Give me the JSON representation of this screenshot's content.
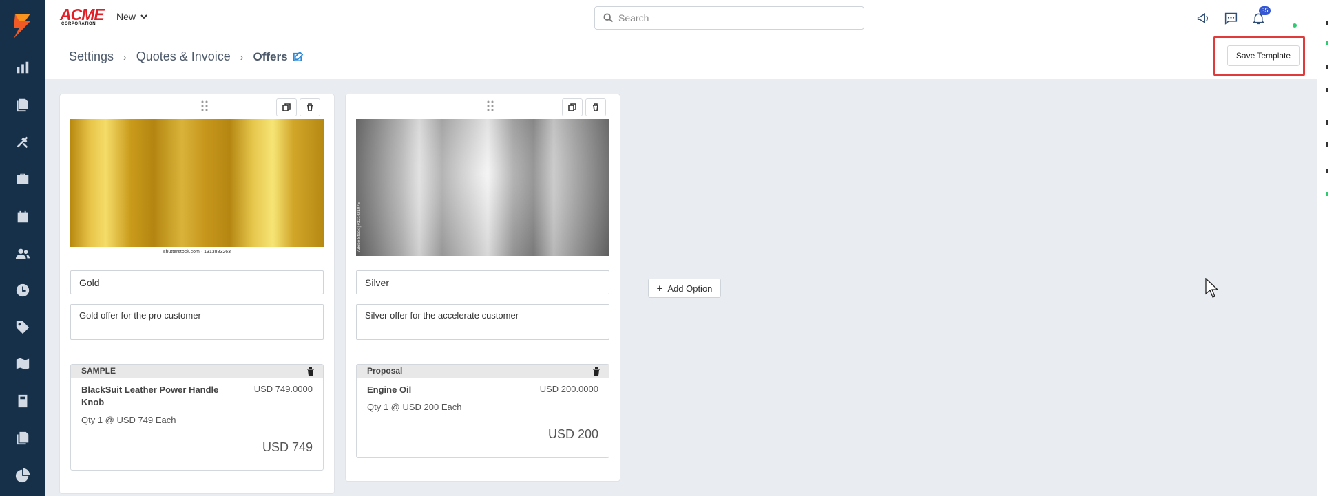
{
  "brand": {
    "name": "ACME",
    "sub": "CORPORATION"
  },
  "topbar": {
    "new_label": "New",
    "search_placeholder": "Search",
    "notification_count": "35"
  },
  "breadcrumb": {
    "items": [
      "Settings",
      "Quotes & Invoice"
    ],
    "current": "Offers"
  },
  "toolbar": {
    "save_label": "Save Template"
  },
  "offers": [
    {
      "image": "gold",
      "image_caption": "shutterstock.com · 1313883263",
      "name": "Gold",
      "description": "Gold offer for the pro customer",
      "section_title": "SAMPLE",
      "item_name": "BlackSuit Leather Power Handle Knob",
      "item_price": "USD 749.0000",
      "item_qty": "Qty 1 @ USD 749 Each",
      "total": "USD 749"
    },
    {
      "image": "silver",
      "image_caption": "Adobe Stock | #321421975",
      "name": "Silver",
      "description": "Silver offer for the accelerate customer",
      "section_title": "Proposal",
      "item_name": "Engine Oil",
      "item_price": "USD 200.0000",
      "item_qty": "Qty 1 @ USD 200 Each",
      "total": "USD 200"
    }
  ],
  "add_option_label": "Add Option",
  "colors": {
    "sidebar": "#17304a",
    "canvas": "#e9edf2",
    "highlight": "#e03a3a",
    "accent": "#2c8ad9",
    "badge": "#3457d5"
  }
}
